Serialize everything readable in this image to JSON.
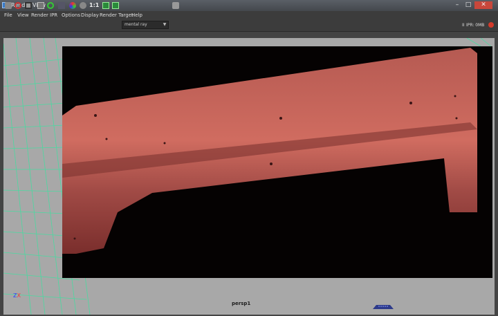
{
  "window": {
    "title": "Render View"
  },
  "menu": [
    "File",
    "View",
    "Render",
    "IPR",
    "Options",
    "Display",
    "Render Target",
    "Help"
  ],
  "toolbar": {
    "icons": [
      "render-frame-icon",
      "redo-render-icon",
      "render-region-icon",
      "snapshot-icon",
      "refresh-icon",
      "ipr-tuning-icon",
      "color-channels-icon",
      "alpha-channel-icon",
      "real-size-icon",
      "keep-image-icon",
      "remove-image-icon",
      "render-settings-icon"
    ],
    "real_size_label": "1:1",
    "renderer": "mental ray",
    "ipr_status": "IPR: 0MB",
    "pause": "II"
  },
  "viewport": {
    "camera_label": "persp1",
    "axis": {
      "z": "Z",
      "x": "X"
    }
  },
  "colors": {
    "render_body": "#c8645a",
    "render_background": "#050202",
    "wireframe": "#3fe0a0",
    "viewport_bg": "#a8a8a8"
  }
}
